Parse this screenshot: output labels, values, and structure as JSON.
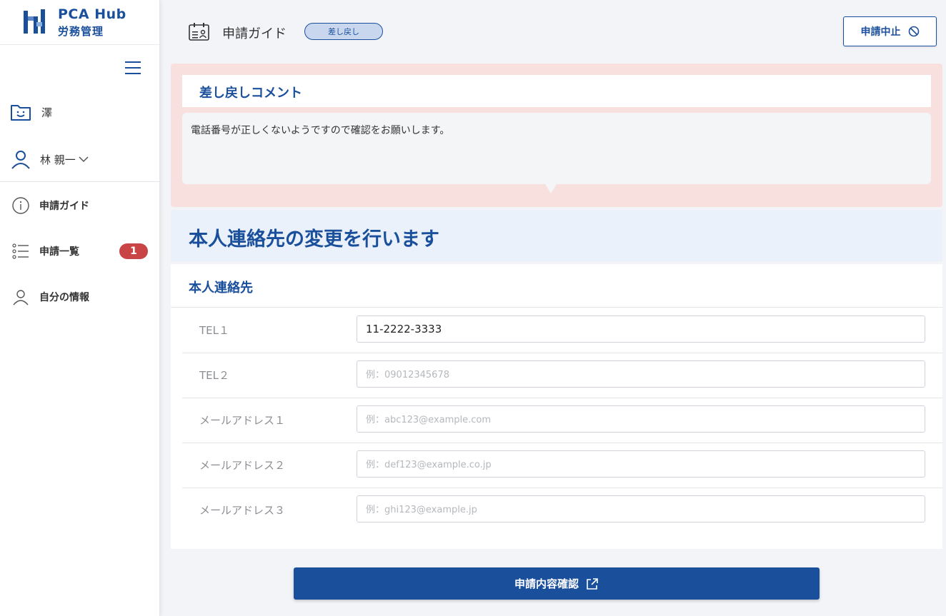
{
  "brand": {
    "name": "PCA Hub",
    "sub": "労務管理"
  },
  "sidebar": {
    "company": "澤",
    "user": "林 親一",
    "nav": [
      {
        "label": "申請ガイド"
      },
      {
        "label": "申請一覧",
        "badge": "1"
      },
      {
        "label": "自分の情報"
      }
    ]
  },
  "header": {
    "title": "申請ガイド",
    "status": "差し戻し",
    "cancel_label": "申請中止"
  },
  "comment": {
    "title": "差し戻しコメント",
    "text": "電話番号が正しくないようですので確認をお願いします。"
  },
  "main": {
    "heading": "本人連絡先の変更を行います",
    "card_title": "本人連絡先",
    "fields": [
      {
        "label": "TEL１",
        "value": "11-2222-3333",
        "placeholder": ""
      },
      {
        "label": "TEL２",
        "value": "",
        "placeholder": "例：09012345678"
      },
      {
        "label": "メールアドレス１",
        "value": "",
        "placeholder": "例：abc123@example.com"
      },
      {
        "label": "メールアドレス２",
        "value": "",
        "placeholder": "例：def123@example.co.jp"
      },
      {
        "label": "メールアドレス３",
        "value": "",
        "placeholder": "例：ghi123@example.jp"
      }
    ],
    "confirm_label": "申請内容確認"
  },
  "colors": {
    "primary": "#1a4f9c",
    "badge": "#c94545",
    "comment_bg": "#f8e0de"
  }
}
